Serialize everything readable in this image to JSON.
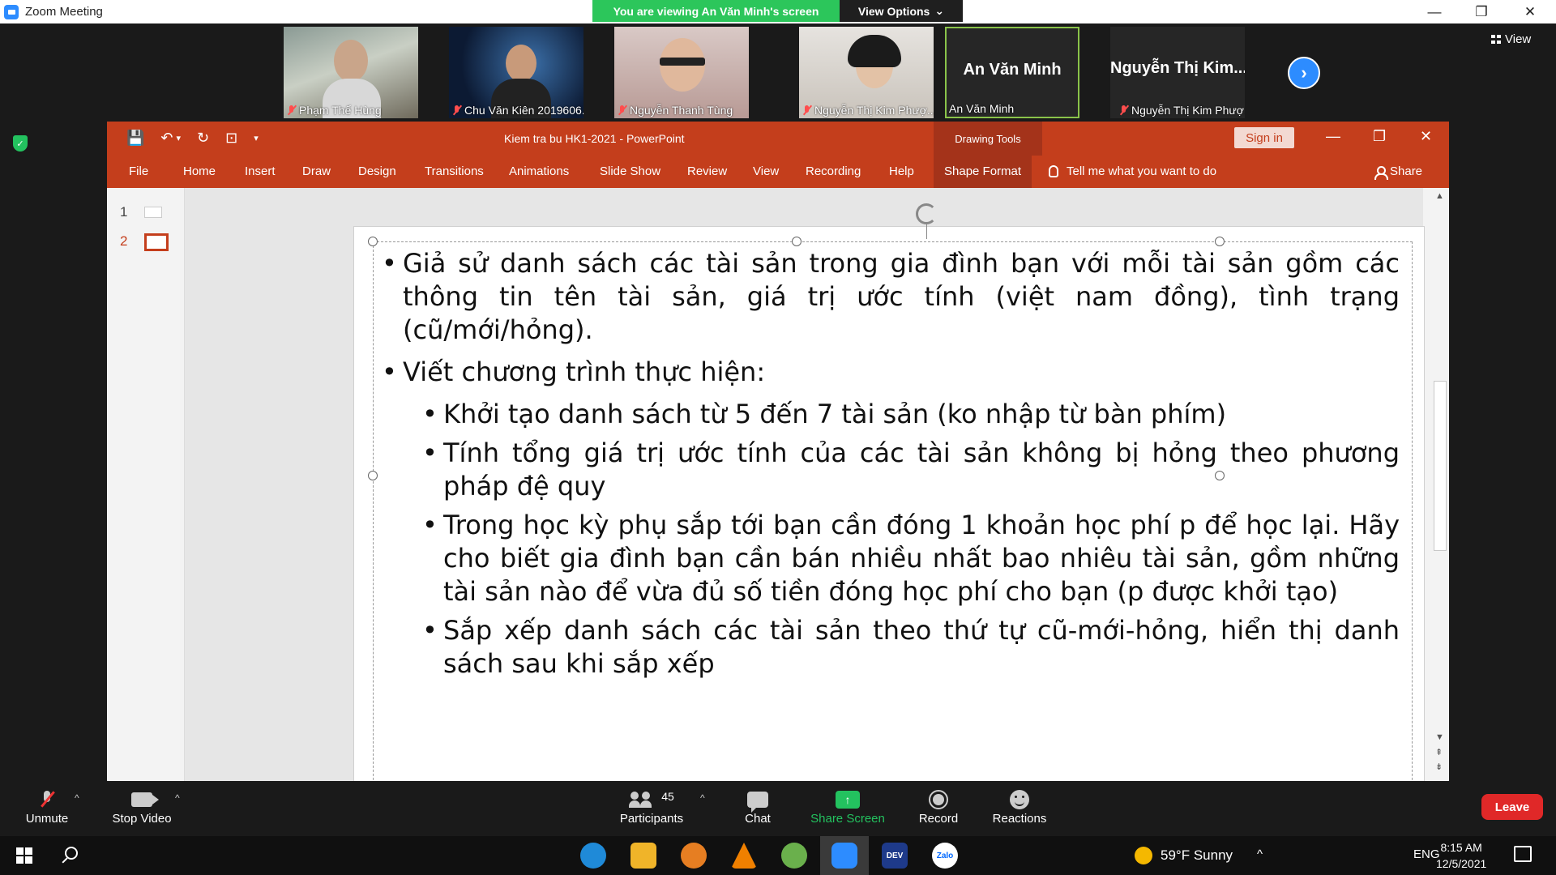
{
  "window": {
    "title": "Zoom Meeting",
    "viewing_banner": "You are viewing An Văn Minh's screen",
    "view_options": "View Options",
    "chevron": "⌄",
    "minimize": "—",
    "restore": "❐",
    "close": "✕"
  },
  "gallery": {
    "participants": [
      {
        "name": "Phạm Thế Hùng",
        "muted": true,
        "video": true
      },
      {
        "name": "Chu Văn Kiên 2019606...",
        "muted": true,
        "video": true
      },
      {
        "name": "Nguyễn Thanh Tùng",
        "muted": true,
        "video": true
      },
      {
        "name": "Nguyễn Thị Kim Phượ...",
        "muted": true,
        "video": true
      },
      {
        "name": "An Văn Minh",
        "big_name": "An Văn Minh",
        "muted": false,
        "video": false,
        "active_speaker": true
      },
      {
        "name": "Nguyễn Thị Kim Phượ...",
        "big_name": "Nguyễn  Thị  Kim...",
        "muted": true,
        "video": false
      }
    ],
    "next_arrow": "›",
    "view_label": "View"
  },
  "powerpoint": {
    "doc_title": "Kiem tra bu HK1-2021  -  PowerPoint",
    "drawing_tools": "Drawing Tools",
    "sign_in": "Sign in",
    "minimize": "—",
    "restore": "❐",
    "close": "✕",
    "qat": {
      "save": "💾",
      "undo": "↶",
      "dropdown": "▾",
      "redo": "↻",
      "present": "⊡",
      "more": "▾"
    },
    "tabs": [
      "File",
      "Home",
      "Insert",
      "Draw",
      "Design",
      "Transitions",
      "Animations",
      "Slide Show",
      "Review",
      "View",
      "Recording",
      "Help",
      "Shape Format"
    ],
    "active_tab": "Shape Format",
    "tell_me": "Tell me what you want to do",
    "share": "Share",
    "slides": [
      {
        "number": "1"
      },
      {
        "number": "2",
        "selected": true
      }
    ],
    "scroll_up": "▲",
    "scroll_down": "▼",
    "scroll_prev": "⇞",
    "scroll_next": "⇟",
    "slide_content": {
      "bullets": [
        {
          "level": 1,
          "text": "Giả sử danh sách các tài sản trong gia đình bạn với mỗi tài sản gồm các thông tin tên tài sản, giá trị ước tính (việt nam đồng), tình trạng (cũ/mới/hỏng)."
        },
        {
          "level": 1,
          "text": "Viết chương trình thực hiện:"
        },
        {
          "level": 2,
          "text": "Khởi tạo danh sách từ 5 đến 7 tài sản (ko nhập từ bàn phím)"
        },
        {
          "level": 2,
          "text": "Tính tổng giá trị ước tính của các tài sản không bị hỏng theo phương pháp đệ quy"
        },
        {
          "level": 2,
          "text": "Trong học kỳ phụ sắp tới bạn cần đóng 1 khoản học phí p để học lại. Hãy cho biết gia đình bạn cần bán nhiều nhất bao nhiêu tài sản, gồm những tài sản nào để vừa đủ số tiền đóng học phí cho bạn (p được khởi tạo)"
        },
        {
          "level": 2,
          "text": "Sắp xếp danh sách các tài sản theo thứ tự cũ-mới-hỏng, hiển thị danh sách sau khi sắp xếp"
        }
      ]
    }
  },
  "security_icon": "✓",
  "toolbar": {
    "unmute": "Unmute",
    "stop_video": "Stop Video",
    "participants": "Participants",
    "participants_count": "45",
    "chat": "Chat",
    "share_screen": "Share Screen",
    "share_arrow": "↑",
    "record": "Record",
    "reactions": "Reactions",
    "leave": "Leave",
    "caret": "^"
  },
  "taskbar": {
    "weather": "59°F  Sunny",
    "tray_caret": "^",
    "language": "ENG",
    "time": "8:15 AM",
    "date": "12/5/2021",
    "apps": [
      {
        "name": "edge",
        "color": "#1f8ad8",
        "label": ""
      },
      {
        "name": "file-explorer",
        "color": "#f0b429",
        "label": ""
      },
      {
        "name": "fl-studio",
        "color": "#e67e22",
        "label": ""
      },
      {
        "name": "vlc",
        "color": "#f08000",
        "label": ""
      },
      {
        "name": "green-app",
        "color": "#6ab04c",
        "label": ""
      },
      {
        "name": "zoom",
        "color": "#2d8cff",
        "label": ""
      },
      {
        "name": "dev-cpp",
        "color": "#1e3a8a",
        "label": "DEV"
      },
      {
        "name": "zalo",
        "color": "#ffffff",
        "label": "Zalo"
      }
    ]
  }
}
